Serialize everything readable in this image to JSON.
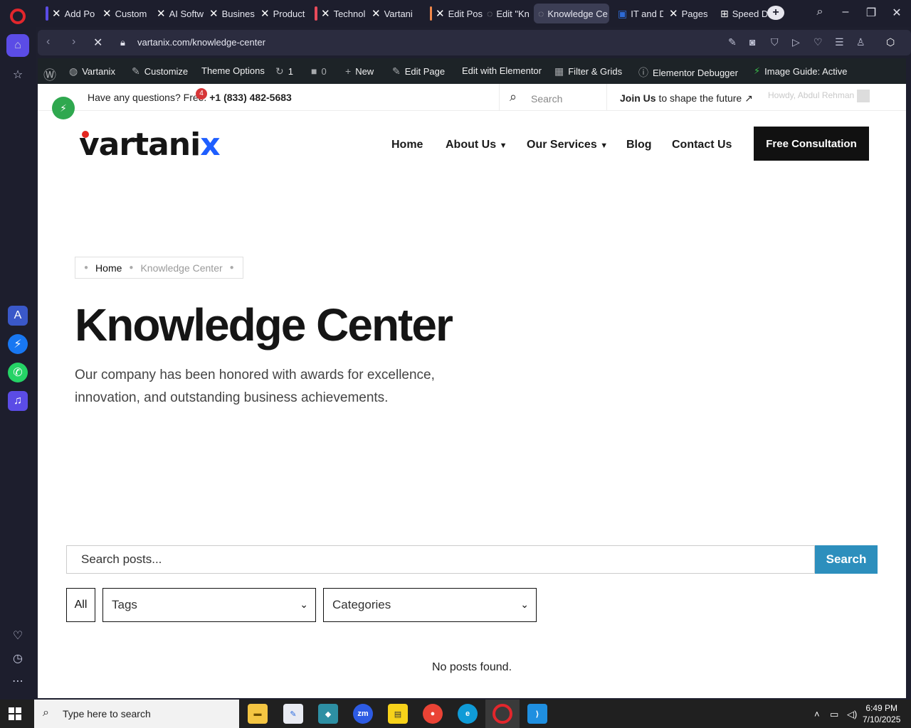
{
  "browser": {
    "tabs": [
      {
        "label": "Add Po",
        "stripe": "#5b4ce6"
      },
      {
        "label": "Custom",
        "stripe": ""
      },
      {
        "label": "AI Softw",
        "stripe": ""
      },
      {
        "label": "Busines",
        "stripe": ""
      },
      {
        "label": "Product",
        "stripe": ""
      },
      {
        "label": "Technol",
        "stripe": "#e84b5b"
      },
      {
        "label": "Vartani",
        "stripe": ""
      },
      {
        "label": "Edit Pos",
        "stripe": "#f0874a"
      },
      {
        "label": "Edit \"Kn",
        "stripe": ""
      },
      {
        "label": "Knowledge Ce",
        "stripe": ""
      },
      {
        "label": "IT and D",
        "stripe": ""
      },
      {
        "label": "Pages",
        "stripe": ""
      },
      {
        "label": "Speed D",
        "stripe": ""
      }
    ],
    "url": "vartanix.com/knowledge-center"
  },
  "wpbar": {
    "site": "Vartanix",
    "customize": "Customize",
    "theme_options": "Theme Options",
    "updates": "1",
    "comments": "0",
    "new": "New",
    "edit_page": "Edit Page",
    "edit_elementor": "Edit with Elementor",
    "filter_grids": "Filter & Grids",
    "elementor_debugger": "Elementor Debugger",
    "image_guide": "Image Guide: Active"
  },
  "topinfo": {
    "question": "Have any questions? Free:",
    "phone": "+1 (833) 482-5683",
    "badge": "4",
    "search_placeholder": "Search",
    "join_bold": "Join Us",
    "join_rest": " to shape the future",
    "howdy": "Howdy, Abdul Rehman"
  },
  "header": {
    "logo_main": "vartani",
    "logo_x": "x",
    "nav": [
      "Home",
      "About Us",
      "Our Services",
      "Blog",
      "Contact Us"
    ],
    "cta": "Free Consultation"
  },
  "breadcrumb": {
    "home": "Home",
    "current": "Knowledge Center"
  },
  "hero": {
    "title": "Knowledge Center",
    "lede": "Our company has been honored with awards for excellence, innovation, and outstanding business achievements."
  },
  "search": {
    "placeholder": "Search posts...",
    "button": "Search"
  },
  "filters": {
    "all": "All",
    "tags": "Tags",
    "categories": "Categories"
  },
  "empty_state": "No posts found.",
  "taskbar": {
    "search_placeholder": "Type here to search",
    "zoom_label": "zm",
    "time": "6:49 PM",
    "date": "7/10/2025"
  }
}
